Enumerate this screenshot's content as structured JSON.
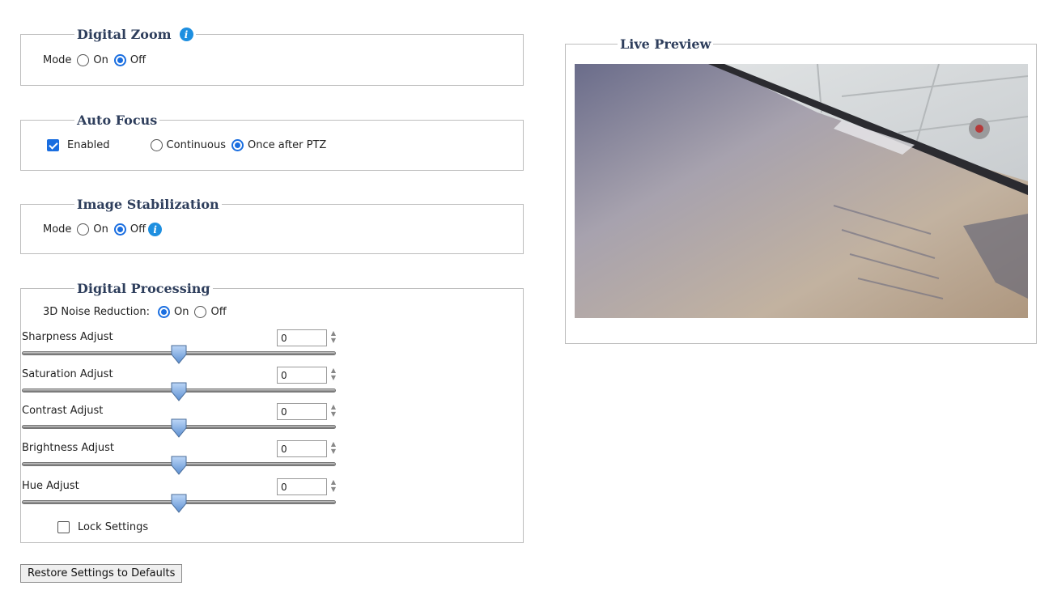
{
  "digital_zoom": {
    "title": "Digital Zoom",
    "mode_label": "Mode",
    "on_label": "On",
    "off_label": "Off",
    "selected": "Off"
  },
  "auto_focus": {
    "title": "Auto Focus",
    "enabled_label": "Enabled",
    "enabled_checked": true,
    "continuous_label": "Continuous",
    "once_label": "Once after PTZ",
    "selected": "Once after PTZ"
  },
  "image_stabilization": {
    "title": "Image Stabilization",
    "mode_label": "Mode",
    "on_label": "On",
    "off_label": "Off",
    "selected": "Off"
  },
  "digital_processing": {
    "title": "Digital Processing",
    "noise_label": "3D Noise Reduction:",
    "on_label": "On",
    "off_label": "Off",
    "noise_selected": "On",
    "sliders": [
      {
        "label": "Sharpness Adjust",
        "value": "0",
        "fraction": 0.5
      },
      {
        "label": "Saturation Adjust",
        "value": "0",
        "fraction": 0.5
      },
      {
        "label": "Contrast Adjust",
        "value": "0",
        "fraction": 0.5
      },
      {
        "label": "Brightness Adjust",
        "value": "0",
        "fraction": 0.5
      },
      {
        "label": "Hue Adjust",
        "value": "0",
        "fraction": 0.5
      }
    ],
    "lock_label": "Lock Settings",
    "lock_checked": false
  },
  "restore_button": "Restore Settings to Defaults",
  "live_preview": {
    "title": "Live Preview"
  },
  "colors": {
    "legend": "#2e3e5c",
    "accent": "#1a6ee0",
    "info": "#1e8fe0"
  }
}
